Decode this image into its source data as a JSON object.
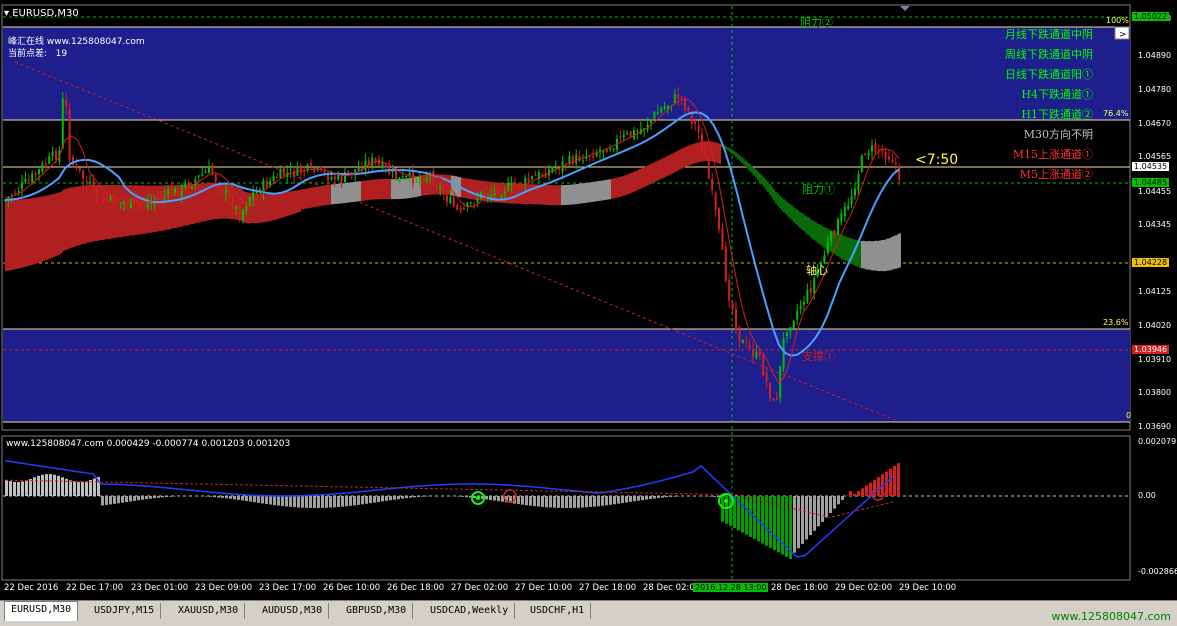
{
  "window": {
    "title": "EURUSD,M30",
    "site_line": "峰汇在线 www.125808047.com",
    "spread_label": "当前点差:",
    "spread_value": "19"
  },
  "price_axis": [
    "1.05000",
    "1.04890",
    "1.04780",
    "1.04670",
    "1.04565",
    "1.04455",
    "1.04345",
    "1.04125",
    "1.04020",
    "1.03910",
    "1.03800",
    "1.03690"
  ],
  "price_tags": {
    "top": "1.05022",
    "current": "1.04535",
    "bid": "1.04485",
    "pivot": "1.04228",
    "low": "1.03946"
  },
  "fib_labels": {
    "f100": "100%",
    "f764": "76.4%",
    "f236": "23.6%",
    "f0": "0"
  },
  "annotations": {
    "resist2": "阻力②",
    "resist1": "阻力①",
    "pivot": "轴心",
    "support1": "支撑①",
    "countdown": "<7:50"
  },
  "status_panel": [
    {
      "text": "月线下跌通道中阴",
      "color": "#00ff00"
    },
    {
      "text": "周线下跌通道中阴",
      "color": "#00ff00"
    },
    {
      "text": "日线下跌通道阳①",
      "color": "#00ff00"
    },
    {
      "text": "H4下跌通道①",
      "color": "#00ff00"
    },
    {
      "text": "H1下跌通道②",
      "color": "#00ff00"
    },
    {
      "text": "M30方向不明",
      "color": "#c0c0c0"
    },
    {
      "text": "M15上涨通道①",
      "color": "#ff3030"
    },
    {
      "text": "M5上涨通道②",
      "color": "#ff3030"
    }
  ],
  "indicator": {
    "header": "www.125808047.com 0.000429 -0.000774 0.001203 0.001203",
    "axis_top": "0.002079",
    "axis_zero": "0.00",
    "axis_bottom": "-0.002866"
  },
  "time_axis": [
    "22 Dec 2016",
    "22 Dec 17:00",
    "23 Dec 01:00",
    "23 Dec 09:00",
    "23 Dec 17:00",
    "26 Dec 10:00",
    "26 Dec 18:00",
    "27 Dec 02:00",
    "27 Dec 10:00",
    "27 Dec 18:00",
    "28 Dec 02:00",
    "28 Dec 18:00",
    "29 Dec 02:00",
    "29 Dec 10:00"
  ],
  "crosshair_time": "2016.12.28 13:00",
  "tabs": [
    "EURUSD,M30",
    "USDJPY,M15",
    "XAUUSD,M30",
    "AUDUSD,M30",
    "GBPUSD,M30",
    "USDCAD,Weekly",
    "USDCHF,H1"
  ],
  "watermark": "www.125808047.com",
  "colors": {
    "zone": "#1e1e8c",
    "bull": "#00c000",
    "bear": "#d02020",
    "ma": "#4aa0ff"
  }
}
